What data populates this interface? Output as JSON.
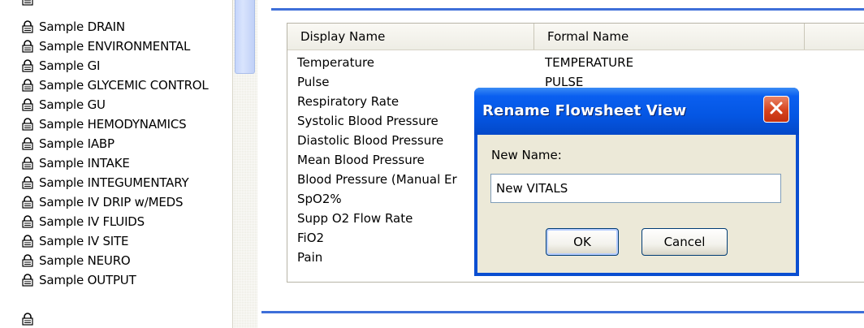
{
  "tree": {
    "items": [
      {
        "label": "Sample DRAIN"
      },
      {
        "label": "Sample ENVIRONMENTAL"
      },
      {
        "label": "Sample GI"
      },
      {
        "label": "Sample GLYCEMIC CONTROL"
      },
      {
        "label": "Sample GU"
      },
      {
        "label": "Sample HEMODYNAMICS"
      },
      {
        "label": "Sample IABP"
      },
      {
        "label": "Sample INTAKE"
      },
      {
        "label": "Sample INTEGUMENTARY"
      },
      {
        "label": "Sample IV DRIP w/MEDS"
      },
      {
        "label": "Sample IV FLUIDS"
      },
      {
        "label": "Sample IV SITE"
      },
      {
        "label": "Sample NEURO"
      },
      {
        "label": "Sample OUTPUT"
      }
    ],
    "icon": "lock-icon"
  },
  "grid": {
    "columns": [
      "Display Name",
      "Formal Name"
    ],
    "rows": [
      {
        "display": "Temperature",
        "formal": "TEMPERATURE"
      },
      {
        "display": "Pulse",
        "formal": "PULSE"
      },
      {
        "display": "Respiratory Rate",
        "formal": ""
      },
      {
        "display": "Systolic Blood Pressure",
        "formal": ""
      },
      {
        "display": "Diastolic Blood Pressure",
        "formal": ""
      },
      {
        "display": "Mean Blood Pressure",
        "formal": ""
      },
      {
        "display": "Blood Pressure (Manual Er",
        "formal": ""
      },
      {
        "display": "SpO2%",
        "formal": ""
      },
      {
        "display": "Supp O2 Flow Rate",
        "formal": ""
      },
      {
        "display": "FiO2",
        "formal": ""
      },
      {
        "display": "Pain",
        "formal": ""
      }
    ]
  },
  "dialog": {
    "title": "Rename Flowsheet View",
    "label": "New Name:",
    "input_value": "New VITALS",
    "ok_label": "OK",
    "cancel_label": "Cancel"
  },
  "colors": {
    "titlebar": "#0456e3",
    "close_button": "#d6431e",
    "dialog_body": "#ece9d8",
    "accent_line": "#3e6fd9"
  }
}
